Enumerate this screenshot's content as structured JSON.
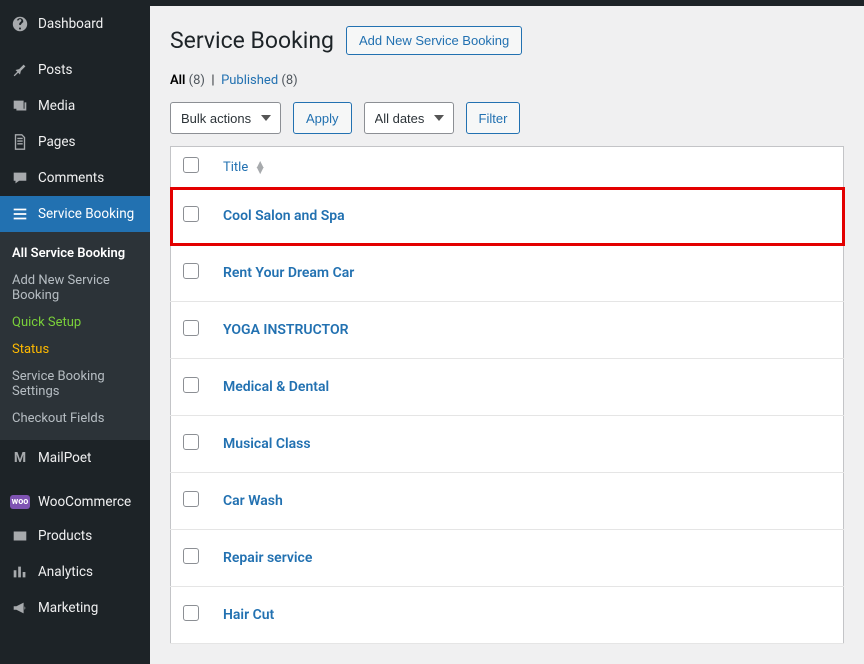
{
  "sidebar": {
    "items": [
      {
        "label": "Dashboard"
      },
      {
        "label": "Posts"
      },
      {
        "label": "Media"
      },
      {
        "label": "Pages"
      },
      {
        "label": "Comments"
      },
      {
        "label": "Service Booking"
      },
      {
        "label": "MailPoet"
      },
      {
        "label": "WooCommerce"
      },
      {
        "label": "Products"
      },
      {
        "label": "Analytics"
      },
      {
        "label": "Marketing"
      }
    ],
    "submenu": [
      {
        "label": "All Service Booking"
      },
      {
        "label": "Add New Service Booking"
      },
      {
        "label": "Quick Setup"
      },
      {
        "label": "Status"
      },
      {
        "label": "Service Booking Settings"
      },
      {
        "label": "Checkout Fields"
      }
    ]
  },
  "header": {
    "title": "Service Booking",
    "add_new": "Add New Service Booking"
  },
  "filters": {
    "all_label": "All",
    "all_count": "(8)",
    "published_label": "Published",
    "published_count": "(8)",
    "separator": "|"
  },
  "actions": {
    "bulk_placeholder": "Bulk actions",
    "apply": "Apply",
    "dates_placeholder": "All dates",
    "filter": "Filter"
  },
  "table": {
    "title_col": "Title",
    "rows": [
      {
        "title": "Cool Salon and Spa"
      },
      {
        "title": "Rent Your Dream Car"
      },
      {
        "title": "YOGA INSTRUCTOR"
      },
      {
        "title": "Medical & Dental"
      },
      {
        "title": "Musical Class"
      },
      {
        "title": "Car Wash"
      },
      {
        "title": "Repair service"
      },
      {
        "title": "Hair Cut"
      }
    ]
  }
}
